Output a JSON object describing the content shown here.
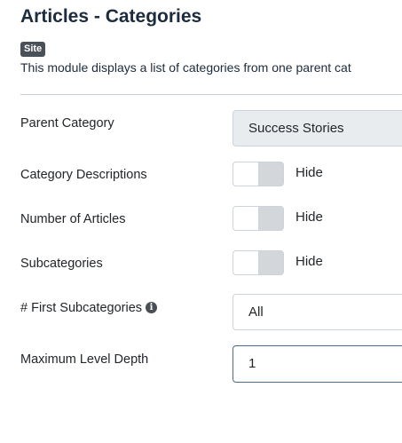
{
  "header": {
    "title": "Articles - Categories",
    "badge": "Site",
    "description": "This module displays a list of categories from one parent cat"
  },
  "fields": {
    "parent_category": {
      "label": "Parent Category",
      "value": "Success Stories"
    },
    "category_descriptions": {
      "label": "Category Descriptions",
      "state": "Hide"
    },
    "number_of_articles": {
      "label": "Number of Articles",
      "state": "Hide"
    },
    "subcategories": {
      "label": "Subcategories",
      "state": "Hide"
    },
    "first_subcategories": {
      "label": "# First Subcategories",
      "value": "All",
      "info_icon": "i"
    },
    "maximum_level_depth": {
      "label": "Maximum Level Depth",
      "value": "1"
    }
  },
  "colors": {
    "title": "#1c2b3d",
    "badge_bg": "#495057",
    "toggle_off": "#d4d7da",
    "input_focus_border": "#4a6a8a"
  }
}
